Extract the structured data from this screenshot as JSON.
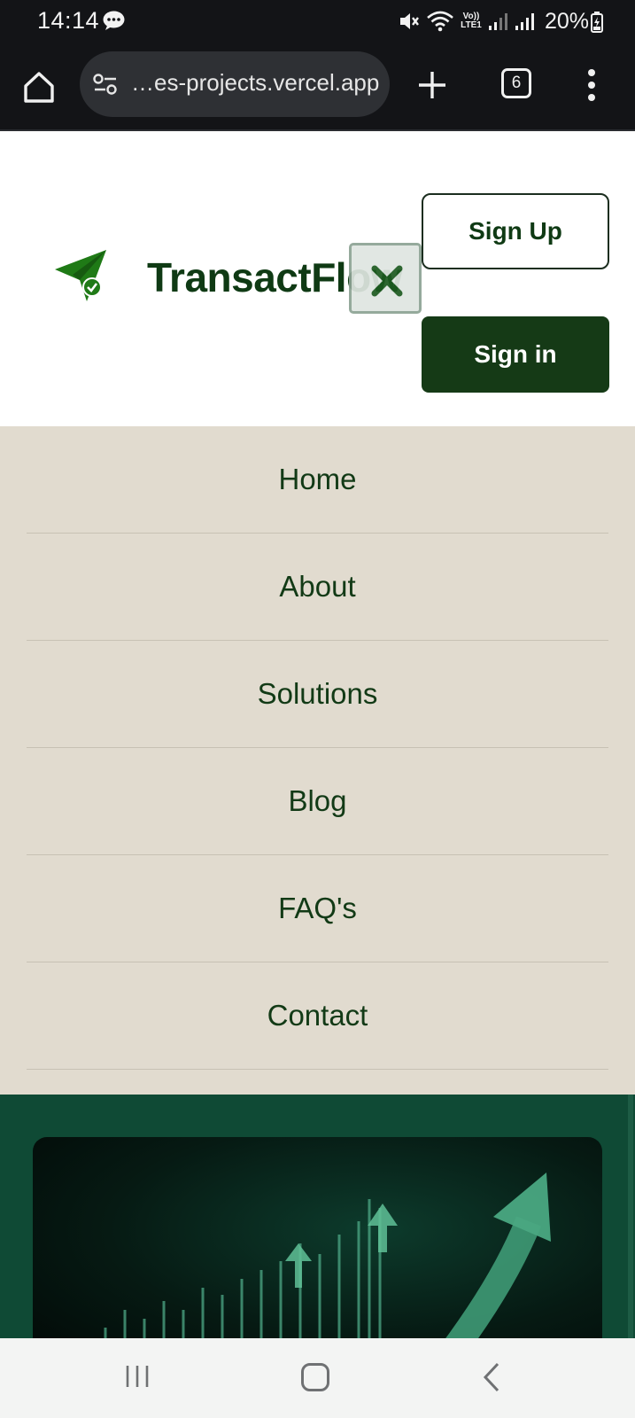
{
  "status_bar": {
    "time": "14:14",
    "battery_percent": "20%",
    "icons": [
      "message-icon",
      "mute-icon",
      "wifi-icon",
      "volte-icon",
      "signal-icon",
      "signal-icon",
      "battery-charging-icon"
    ],
    "volte_label": "Vo)) LTE1"
  },
  "browser": {
    "url_text": "…es-projects.vercel.app",
    "tab_count": "6",
    "icons": [
      "home-icon",
      "site-settings-icon",
      "plus-icon",
      "tabs-icon",
      "overflow-menu-icon"
    ]
  },
  "header": {
    "brand_name": "TransactFlow",
    "signup_label": "Sign Up",
    "signin_label": "Sign in",
    "colors": {
      "brand_green": "#0f3a14",
      "button_dark": "#153a16",
      "logo_green": "#1f7a16"
    }
  },
  "nav": {
    "items": [
      {
        "label": "Home"
      },
      {
        "label": "About"
      },
      {
        "label": "Solutions"
      },
      {
        "label": "Blog"
      },
      {
        "label": "FAQ's"
      },
      {
        "label": "Contact"
      }
    ],
    "colors": {
      "background": "#e1dbcf",
      "text": "#123a16"
    }
  },
  "hero": {
    "image_subject": "growth-chart-arrow-image",
    "colors": {
      "background": "#0f4a35"
    }
  },
  "android_nav": {
    "icons": [
      "recents-icon",
      "home-icon",
      "back-icon"
    ]
  }
}
